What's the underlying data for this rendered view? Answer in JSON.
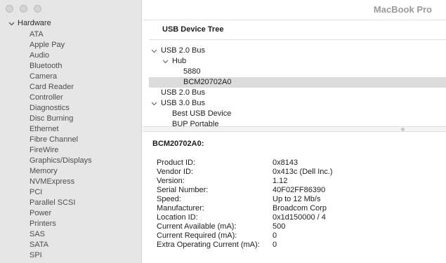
{
  "window": {
    "title": "MacBook Pro"
  },
  "sidebar": {
    "section": "Hardware",
    "items": [
      "ATA",
      "Apple Pay",
      "Audio",
      "Bluetooth",
      "Camera",
      "Card Reader",
      "Controller",
      "Diagnostics",
      "Disc Burning",
      "Ethernet",
      "Fibre Channel",
      "FireWire",
      "Graphics/Displays",
      "Memory",
      "NVMExpress",
      "PCI",
      "Parallel SCSI",
      "Power",
      "Printers",
      "SAS",
      "SATA",
      "SPI"
    ]
  },
  "tree": {
    "header": "USB Device Tree",
    "rows": [
      {
        "label": "USB 2.0 Bus",
        "expanded": true
      },
      {
        "label": "Hub",
        "expanded": true
      },
      {
        "label": "5880"
      },
      {
        "label": "BCM20702A0",
        "selected": true
      },
      {
        "label": "USB 2.0 Bus"
      },
      {
        "label": "USB 3.0 Bus",
        "expanded": true
      },
      {
        "label": "Best USB Device"
      },
      {
        "label": "BUP Portable"
      }
    ]
  },
  "details": {
    "title": "BCM20702A0:",
    "properties": [
      {
        "key": "Product ID:",
        "value": "0x8143"
      },
      {
        "key": "Vendor ID:",
        "value": "0x413c  (Dell Inc.)"
      },
      {
        "key": "Version:",
        "value": "1.12"
      },
      {
        "key": "Serial Number:",
        "value": "40F02FF86390"
      },
      {
        "key": "Speed:",
        "value": "Up to 12 Mb/s"
      },
      {
        "key": "Manufacturer:",
        "value": "Broadcom Corp"
      },
      {
        "key": "Location ID:",
        "value": "0x1d150000 / 4"
      },
      {
        "key": "Current Available (mA):",
        "value": "500"
      },
      {
        "key": "Current Required (mA):",
        "value": "0"
      },
      {
        "key": "Extra Operating Current (mA):",
        "value": "0"
      }
    ]
  }
}
